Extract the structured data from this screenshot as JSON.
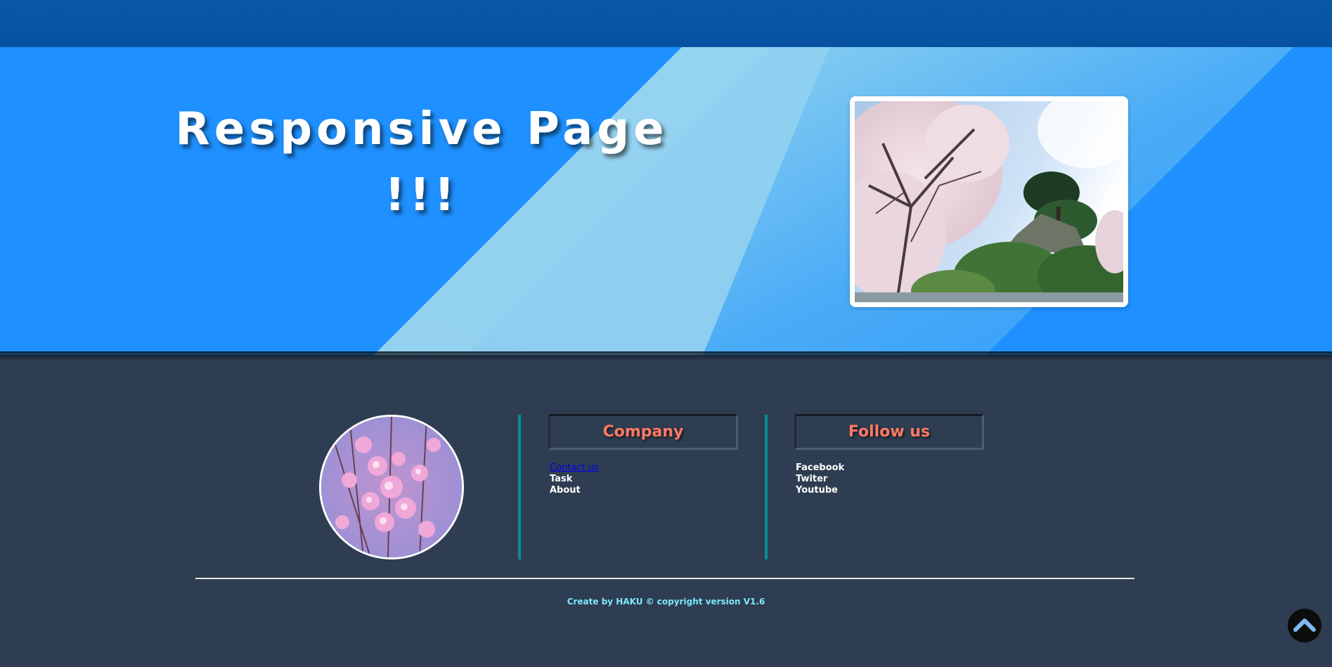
{
  "hero": {
    "title_line1": "Responsive Page",
    "title_line2": "!!!"
  },
  "footer": {
    "company": {
      "heading": "Company",
      "links": [
        "Contact us",
        "Task",
        "About"
      ]
    },
    "follow": {
      "heading": "Follow us",
      "links": [
        "Facebook",
        "Twiter",
        "Youtube"
      ]
    },
    "copyright": "Create by HAKU © copyright version V1.6"
  },
  "colors": {
    "topbar": "#0752a0",
    "hero_bg": "#1e90ff",
    "hero_stripe": "#87ceeb",
    "footer_bg": "#2e3d51",
    "heading_text": "#ff7a63",
    "divider": "#0b8c96",
    "copyright_text": "#7de8ff"
  },
  "icons": {
    "scroll_top": "chevron-up-icon"
  }
}
